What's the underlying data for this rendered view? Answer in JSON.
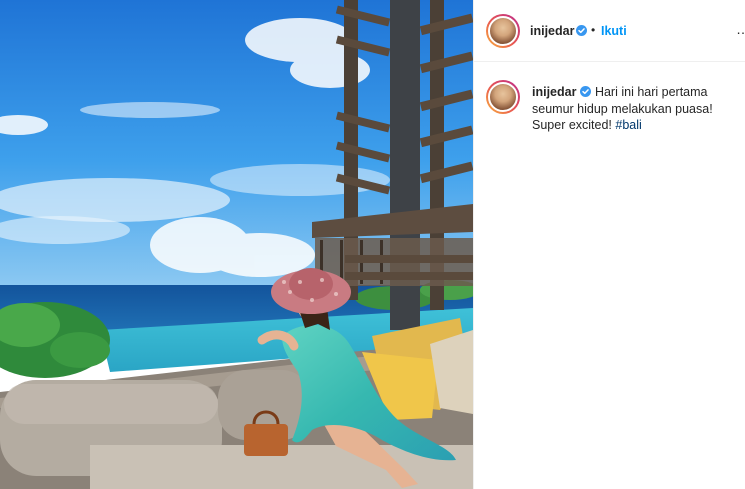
{
  "post": {
    "username": "inijedar",
    "verified_icon": "verified-badge-icon",
    "separator": "•",
    "follow_label": "Ikuti",
    "more_icon": "more-options-icon",
    "more_label": "…",
    "caption_text": "Hari ini hari pertama seumur hidup melakukan puasa! Super excited!",
    "hashtag": "#bali"
  },
  "colors": {
    "accent": "#0095f6",
    "verified": "#3897f0",
    "hashtag": "#00376b",
    "text": "#262626",
    "divider": "#efefef"
  }
}
